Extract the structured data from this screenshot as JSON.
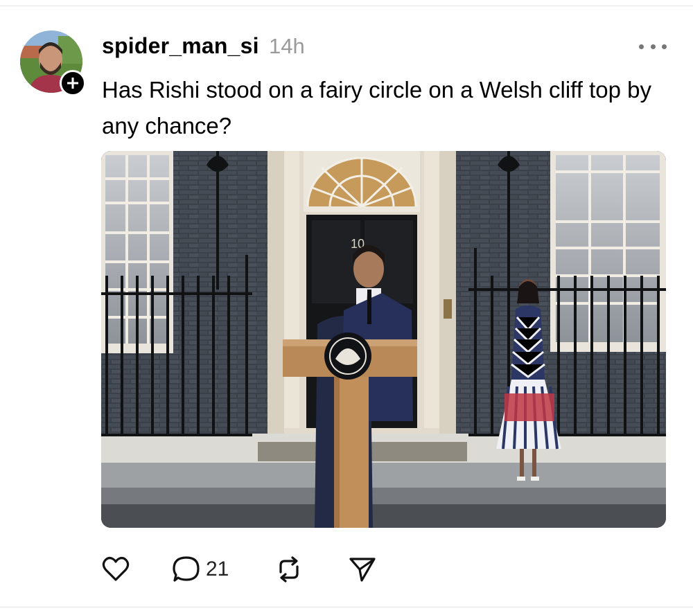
{
  "post": {
    "username": "spider_man_si",
    "timestamp": "14h",
    "text": "Has Rishi stood on a fairy circle on a Welsh cliff top by any chance?",
    "image_alt": "Man speaking at a lectern outside a black door numbered 10, woman in striped dress standing to the right",
    "door_number": "10"
  },
  "actions": {
    "like_icon": "heart-icon",
    "reply_icon": "speech-bubble-icon",
    "reply_count": "21",
    "repost_icon": "repost-icon",
    "share_icon": "send-icon"
  },
  "colors": {
    "text": "#000000",
    "muted": "#9a9a9a",
    "brick": "#3c414a",
    "stone": "#e2dbcd",
    "lectern": "#b98a57"
  }
}
